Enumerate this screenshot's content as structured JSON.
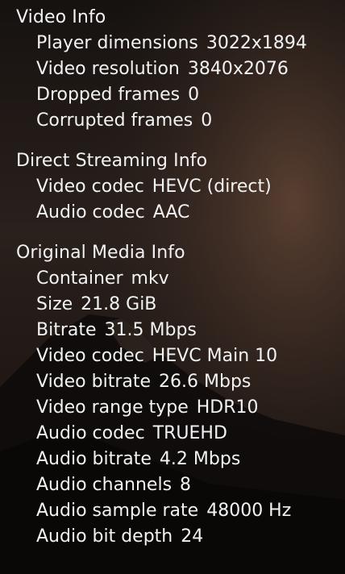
{
  "sections": [
    {
      "title": "Video Info",
      "rows": [
        {
          "label": "Player dimensions",
          "value": "3022x1894"
        },
        {
          "label": "Video resolution",
          "value": "3840x2076"
        },
        {
          "label": "Dropped frames",
          "value": "0"
        },
        {
          "label": "Corrupted frames",
          "value": "0"
        }
      ]
    },
    {
      "title": "Direct Streaming Info",
      "rows": [
        {
          "label": "Video codec",
          "value": "HEVC (direct)"
        },
        {
          "label": "Audio codec",
          "value": "AAC"
        }
      ]
    },
    {
      "title": "Original Media Info",
      "rows": [
        {
          "label": "Container",
          "value": "mkv"
        },
        {
          "label": "Size",
          "value": "21.8 GiB"
        },
        {
          "label": "Bitrate",
          "value": "31.5 Mbps"
        },
        {
          "label": "Video codec",
          "value": "HEVC Main 10"
        },
        {
          "label": "Video bitrate",
          "value": "26.6 Mbps"
        },
        {
          "label": "Video range type",
          "value": "HDR10"
        },
        {
          "label": "Audio codec",
          "value": "TRUEHD"
        },
        {
          "label": "Audio bitrate",
          "value": "4.2 Mbps"
        },
        {
          "label": "Audio channels",
          "value": "8"
        },
        {
          "label": "Audio sample rate",
          "value": "48000 Hz"
        },
        {
          "label": "Audio bit depth",
          "value": "24"
        }
      ]
    }
  ]
}
